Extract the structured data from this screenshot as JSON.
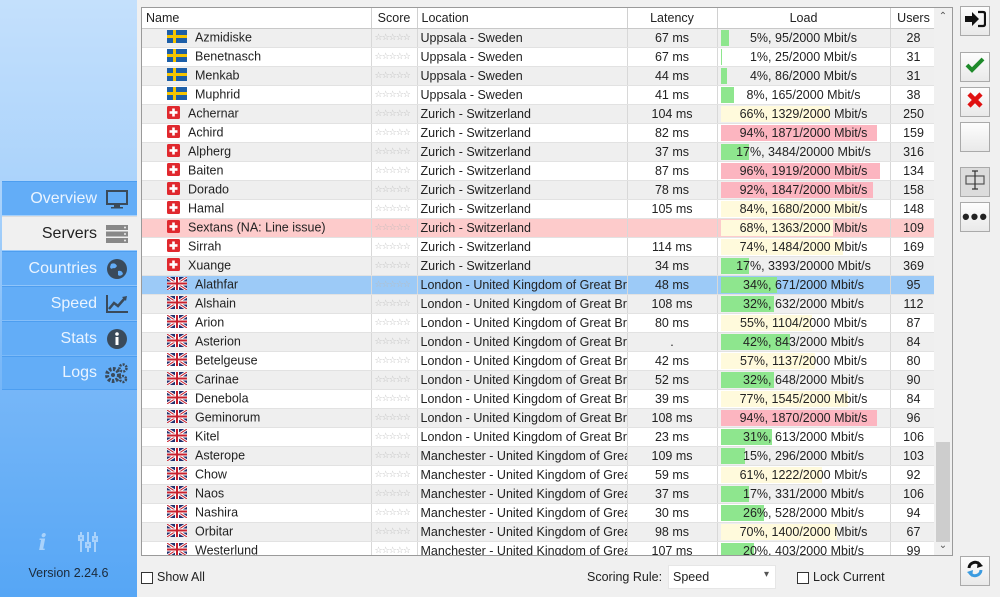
{
  "sidebar": {
    "items": [
      {
        "label": "Overview",
        "icon": "monitor-icon",
        "active": false
      },
      {
        "label": "Servers",
        "icon": "server-icon",
        "active": true
      },
      {
        "label": "Countries",
        "icon": "globe-icon",
        "active": false
      },
      {
        "label": "Speed",
        "icon": "chart-icon",
        "active": false
      },
      {
        "label": "Stats",
        "icon": "info-icon",
        "active": false
      },
      {
        "label": "Logs",
        "icon": "gears-icon",
        "active": false
      }
    ],
    "bottom_icons": [
      "info-italic-icon",
      "sliders-icon"
    ],
    "version": "Version 2.24.6"
  },
  "table": {
    "columns": [
      "Name",
      "Score",
      "Location",
      "Latency",
      "Load",
      "Users"
    ],
    "rows": [
      {
        "name": "Azmidiske",
        "flag": "se",
        "score": "☆☆☆☆☆",
        "location": "Uppsala - Sweden",
        "latency": "67 ms",
        "load": "5%, 95/2000 Mbit/s",
        "load_pct": 5,
        "users": "28",
        "state": ""
      },
      {
        "name": "Benetnasch",
        "flag": "se",
        "score": "☆☆☆☆☆",
        "location": "Uppsala - Sweden",
        "latency": "67 ms",
        "load": "1%, 25/2000 Mbit/s",
        "load_pct": 1,
        "users": "31",
        "state": ""
      },
      {
        "name": "Menkab",
        "flag": "se",
        "score": "☆☆☆☆☆",
        "location": "Uppsala - Sweden",
        "latency": "44 ms",
        "load": "4%, 86/2000 Mbit/s",
        "load_pct": 4,
        "users": "31",
        "state": ""
      },
      {
        "name": "Muphrid",
        "flag": "se",
        "score": "☆☆☆☆☆",
        "location": "Uppsala - Sweden",
        "latency": "41 ms",
        "load": "8%, 165/2000 Mbit/s",
        "load_pct": 8,
        "users": "38",
        "state": ""
      },
      {
        "name": "Achernar",
        "flag": "ch",
        "score": "☆☆☆☆☆",
        "location": "Zurich - Switzerland",
        "latency": "104 ms",
        "load": "66%, 1329/2000 Mbit/s",
        "load_pct": 66,
        "users": "250",
        "state": ""
      },
      {
        "name": "Achird",
        "flag": "ch",
        "score": "☆☆☆☆☆",
        "location": "Zurich - Switzerland",
        "latency": "82 ms",
        "load": "94%, 1871/2000 Mbit/s",
        "load_pct": 94,
        "users": "159",
        "state": ""
      },
      {
        "name": "Alpherg",
        "flag": "ch",
        "score": "☆☆☆☆☆",
        "location": "Zurich - Switzerland",
        "latency": "37 ms",
        "load": "17%, 3484/20000 Mbit/s",
        "load_pct": 17,
        "users": "316",
        "state": ""
      },
      {
        "name": "Baiten",
        "flag": "ch",
        "score": "☆☆☆☆☆",
        "location": "Zurich - Switzerland",
        "latency": "87 ms",
        "load": "96%, 1919/2000 Mbit/s",
        "load_pct": 96,
        "users": "134",
        "state": ""
      },
      {
        "name": "Dorado",
        "flag": "ch",
        "score": "☆☆☆☆☆",
        "location": "Zurich - Switzerland",
        "latency": "78 ms",
        "load": "92%, 1847/2000 Mbit/s",
        "load_pct": 92,
        "users": "158",
        "state": ""
      },
      {
        "name": "Hamal",
        "flag": "ch",
        "score": "☆☆☆☆☆",
        "location": "Zurich - Switzerland",
        "latency": "105 ms",
        "load": "84%, 1680/2000 Mbit/s",
        "load_pct": 84,
        "users": "148",
        "state": ""
      },
      {
        "name": "Sextans (NA: Line issue)",
        "flag": "ch",
        "score": "☆☆☆☆☆",
        "location": "Zurich - Switzerland",
        "latency": "",
        "load": "68%, 1363/2000 Mbit/s",
        "load_pct": 68,
        "users": "109",
        "state": "error"
      },
      {
        "name": "Sirrah",
        "flag": "ch",
        "score": "☆☆☆☆☆",
        "location": "Zurich - Switzerland",
        "latency": "114 ms",
        "load": "74%, 1484/2000 Mbit/s",
        "load_pct": 74,
        "users": "169",
        "state": ""
      },
      {
        "name": "Xuange",
        "flag": "ch",
        "score": "☆☆☆☆☆",
        "location": "Zurich - Switzerland",
        "latency": "34 ms",
        "load": "17%, 3393/20000 Mbit/s",
        "load_pct": 17,
        "users": "369",
        "state": ""
      },
      {
        "name": "Alathfar",
        "flag": "uk",
        "score": "☆☆☆☆☆",
        "location": "London - United Kingdom of Great Britain",
        "latency": "48 ms",
        "load": "34%, 671/2000 Mbit/s",
        "load_pct": 34,
        "users": "95",
        "state": "selected"
      },
      {
        "name": "Alshain",
        "flag": "uk",
        "score": "☆☆☆☆☆",
        "location": "London - United Kingdom of Great Britain",
        "latency": "108 ms",
        "load": "32%, 632/2000 Mbit/s",
        "load_pct": 32,
        "users": "112",
        "state": ""
      },
      {
        "name": "Arion",
        "flag": "uk",
        "score": "☆☆☆☆☆",
        "location": "London - United Kingdom of Great Britain",
        "latency": "80 ms",
        "load": "55%, 1104/2000 Mbit/s",
        "load_pct": 55,
        "users": "87",
        "state": ""
      },
      {
        "name": "Asterion",
        "flag": "uk",
        "score": "☆☆☆☆☆",
        "location": "London - United Kingdom of Great Britain",
        "latency": ".",
        "load": "42%, 843/2000 Mbit/s",
        "load_pct": 42,
        "users": "84",
        "state": ""
      },
      {
        "name": "Betelgeuse",
        "flag": "uk",
        "score": "☆☆☆☆☆",
        "location": "London - United Kingdom of Great Britain",
        "latency": "42 ms",
        "load": "57%, 1137/2000 Mbit/s",
        "load_pct": 57,
        "users": "80",
        "state": ""
      },
      {
        "name": "Carinae",
        "flag": "uk",
        "score": "☆☆☆☆☆",
        "location": "London - United Kingdom of Great Britain",
        "latency": "52 ms",
        "load": "32%, 648/2000 Mbit/s",
        "load_pct": 32,
        "users": "90",
        "state": ""
      },
      {
        "name": "Denebola",
        "flag": "uk",
        "score": "☆☆☆☆☆",
        "location": "London - United Kingdom of Great Britain",
        "latency": "39 ms",
        "load": "77%, 1545/2000 Mbit/s",
        "load_pct": 77,
        "users": "84",
        "state": ""
      },
      {
        "name": "Geminorum",
        "flag": "uk",
        "score": "☆☆☆☆☆",
        "location": "London - United Kingdom of Great Britain",
        "latency": "108 ms",
        "load": "94%, 1870/2000 Mbit/s",
        "load_pct": 94,
        "users": "96",
        "state": ""
      },
      {
        "name": "Kitel",
        "flag": "uk",
        "score": "☆☆☆☆☆",
        "location": "London - United Kingdom of Great Britain",
        "latency": "23 ms",
        "load": "31%, 613/2000 Mbit/s",
        "load_pct": 31,
        "users": "106",
        "state": ""
      },
      {
        "name": "Asterope",
        "flag": "uk",
        "score": "☆☆☆☆☆",
        "location": "Manchester - United Kingdom of Great Britain",
        "latency": "109 ms",
        "load": "15%, 296/2000 Mbit/s",
        "load_pct": 15,
        "users": "103",
        "state": ""
      },
      {
        "name": "Chow",
        "flag": "uk",
        "score": "☆☆☆☆☆",
        "location": "Manchester - United Kingdom of Great Britain",
        "latency": "59 ms",
        "load": "61%, 1222/2000 Mbit/s",
        "load_pct": 61,
        "users": "92",
        "state": ""
      },
      {
        "name": "Naos",
        "flag": "uk",
        "score": "☆☆☆☆☆",
        "location": "Manchester - United Kingdom of Great Britain",
        "latency": "37 ms",
        "load": "17%, 331/2000 Mbit/s",
        "load_pct": 17,
        "users": "106",
        "state": ""
      },
      {
        "name": "Nashira",
        "flag": "uk",
        "score": "☆☆☆☆☆",
        "location": "Manchester - United Kingdom of Great Britain",
        "latency": "30 ms",
        "load": "26%, 528/2000 Mbit/s",
        "load_pct": 26,
        "users": "94",
        "state": ""
      },
      {
        "name": "Orbitar",
        "flag": "uk",
        "score": "☆☆☆☆☆",
        "location": "Manchester - United Kingdom of Great Britain",
        "latency": "98 ms",
        "load": "70%, 1400/2000 Mbit/s",
        "load_pct": 70,
        "users": "67",
        "state": ""
      },
      {
        "name": "Westerlund",
        "flag": "uk",
        "score": "☆☆☆☆☆",
        "location": "Manchester - United Kingdom of Great Britain",
        "latency": "107 ms",
        "load": "20%, 403/2000 Mbit/s",
        "load_pct": 20,
        "users": "99",
        "state": ""
      }
    ]
  },
  "colors": {
    "load_low": "#8ee68e",
    "load_mid": "#fffadc",
    "load_high": "#fcb5c0",
    "row_selected": "#9ccaf7",
    "row_error": "#fdcbcb"
  },
  "right_buttons": [
    {
      "name": "connect-button",
      "icon": "sign-in-icon"
    },
    {
      "name": "confirm-button",
      "icon": "checkmark-icon"
    },
    {
      "name": "cancel-button",
      "icon": "x-icon"
    },
    {
      "name": "blank-button",
      "icon": ""
    },
    {
      "name": "column-resize-button",
      "icon": "text-cursor-icon"
    },
    {
      "name": "more-button",
      "icon": "ellipsis-icon"
    }
  ],
  "bottom": {
    "show_all_label": "Show All",
    "show_all_checked": false,
    "scoring_label": "Scoring Rule:",
    "scoring_value": "Speed",
    "lock_label": "Lock Current",
    "lock_checked": false
  }
}
